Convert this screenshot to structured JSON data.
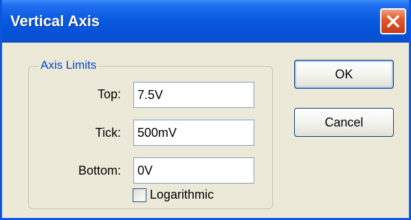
{
  "window": {
    "title": "Vertical Axis"
  },
  "group": {
    "legend": "Axis Limits",
    "top": {
      "label": "Top:",
      "value": "7.5V"
    },
    "tick": {
      "label": "Tick:",
      "value": "500mV"
    },
    "bottom": {
      "label": "Bottom:",
      "value": "0V"
    },
    "logarithmic": {
      "label": "Logarithmic",
      "checked": false
    }
  },
  "buttons": {
    "ok": "OK",
    "cancel": "Cancel"
  },
  "colors": {
    "titlebar": "#0a5be0",
    "legend": "#0046d5",
    "close": "#e25a2c",
    "dialog_bg": "#ece9d8"
  },
  "icons": {
    "close": "close-icon"
  }
}
